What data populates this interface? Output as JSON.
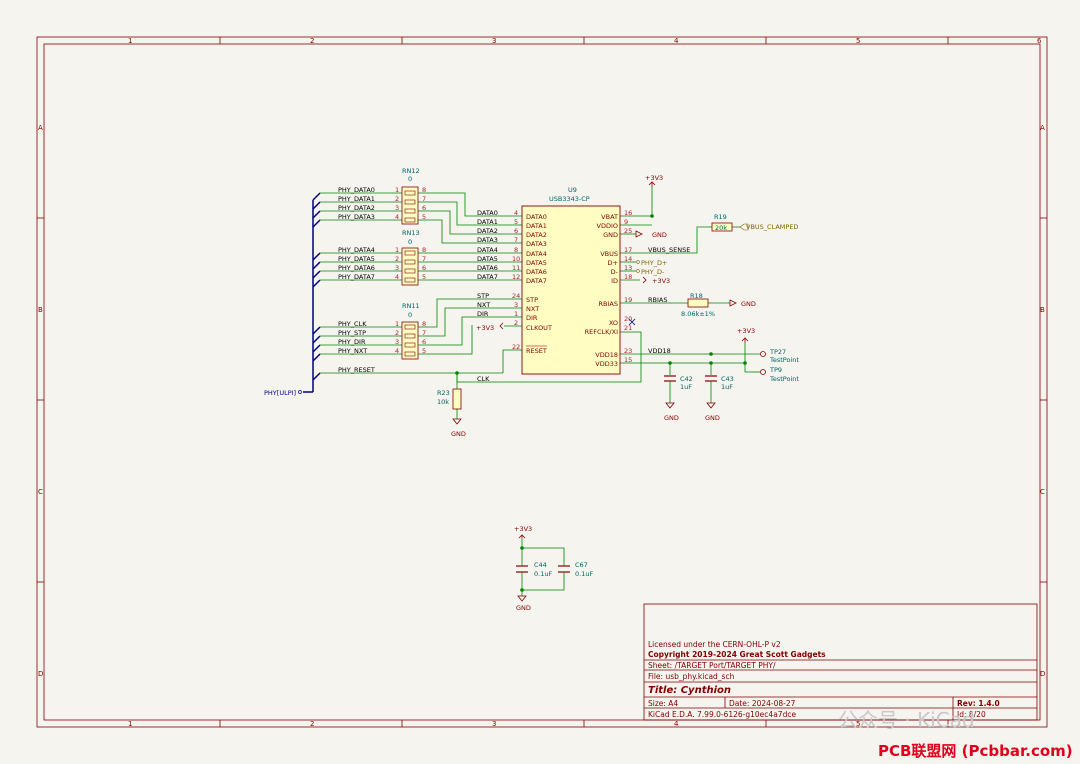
{
  "frame": {
    "cols": [
      "1",
      "2",
      "3",
      "4",
      "5",
      "6"
    ],
    "rows": [
      "A",
      "B",
      "C",
      "D"
    ]
  },
  "rn12": {
    "ref": "RN12",
    "val": "0"
  },
  "rn13": {
    "ref": "RN13",
    "val": "0"
  },
  "rn11": {
    "ref": "RN11",
    "val": "0"
  },
  "u9": {
    "ref": "U9",
    "val": "USB3343-CP",
    "left_pins": [
      "DATA0",
      "DATA1",
      "DATA2",
      "DATA3",
      "DATA4",
      "DATA5",
      "DATA6",
      "DATA7",
      "STP",
      "NXT",
      "DIR",
      "CLKOUT",
      "RESET"
    ],
    "left_nums": [
      "4",
      "5",
      "6",
      "7",
      "8",
      "10",
      "11",
      "12",
      "24",
      "3",
      "1",
      "2",
      "22"
    ],
    "right_pins": [
      "VBAT",
      "VDDIO",
      "GND",
      "VBUS",
      "D+",
      "D-",
      "ID",
      "RBIAS",
      "XO",
      "REFCLK/XI",
      "VDD18",
      "VDD33"
    ],
    "right_nums": [
      "16",
      "9",
      "25",
      "17",
      "14",
      "13",
      "18",
      "19",
      "20",
      "21",
      "23",
      "15"
    ]
  },
  "nets": {
    "phy_data": [
      "PHY_DATA0",
      "PHY_DATA1",
      "PHY_DATA2",
      "PHY_DATA3",
      "PHY_DATA4",
      "PHY_DATA5",
      "PHY_DATA6",
      "PHY_DATA7"
    ],
    "data": [
      "DATA0",
      "DATA1",
      "DATA2",
      "DATA3",
      "DATA4",
      "DATA5",
      "DATA6",
      "DATA7"
    ],
    "phy_ctrl": [
      "PHY_CLK",
      "PHY_STP",
      "PHY_DIR",
      "PHY_NXT"
    ],
    "ctrl": [
      "STP",
      "NXT",
      "DIR"
    ],
    "phy_reset": "PHY_RESET",
    "clk": "CLK",
    "vbus_sense": "VBUS_SENSE",
    "rbias": "RBIAS",
    "vdd18": "VDD18",
    "bus": "PHY[ULPI]",
    "vbus_clamped": "VBUS_CLAMPED",
    "phy_dp": "PHY_D+",
    "phy_dm": "PHY_D-"
  },
  "rn_pins_left": [
    "1",
    "2",
    "3",
    "4"
  ],
  "rn_pins_right": [
    "8",
    "7",
    "6",
    "5"
  ],
  "power": {
    "v33": "+3V3",
    "gnd": "GND"
  },
  "r19": {
    "ref": "R19",
    "val": "20k"
  },
  "r18": {
    "ref": "R18",
    "val": "8.06k±1%"
  },
  "r23": {
    "ref": "R23",
    "val": "10k"
  },
  "c42": {
    "ref": "C42",
    "val": "1uF"
  },
  "c43": {
    "ref": "C43",
    "val": "1uF"
  },
  "c44": {
    "ref": "C44",
    "val": "0.1uF"
  },
  "c67": {
    "ref": "C67",
    "val": "0.1uF"
  },
  "tp27": {
    "ref": "TP27",
    "val": "TestPoint"
  },
  "tp9": {
    "ref": "TP9",
    "val": "TestPoint"
  },
  "titleblock": {
    "license": "Licensed under the CERN-OHL-P v2",
    "copyright": "Copyright 2019-2024 Great Scott Gadgets",
    "sheet": "Sheet: /TARGET Port/TARGET PHY/",
    "file": "File: usb_phy.kicad_sch",
    "title": "Title: Cynthion",
    "size": "Size: A4",
    "date": "Date: 2024-08-27",
    "rev": "Rev: 1.4.0",
    "tool": "KiCad E.D.A. 7.99.0-6126-g10ec4a7dce",
    "id": "Id: 8/20"
  },
  "watermark": {
    "text": "公众号 · KiCad",
    "site": "PCB联盟网 (Pcbbar.com)"
  },
  "colors": {
    "frame": "#840000",
    "wire": "#008400",
    "bus": "#000084",
    "body": "#fffdc2"
  }
}
